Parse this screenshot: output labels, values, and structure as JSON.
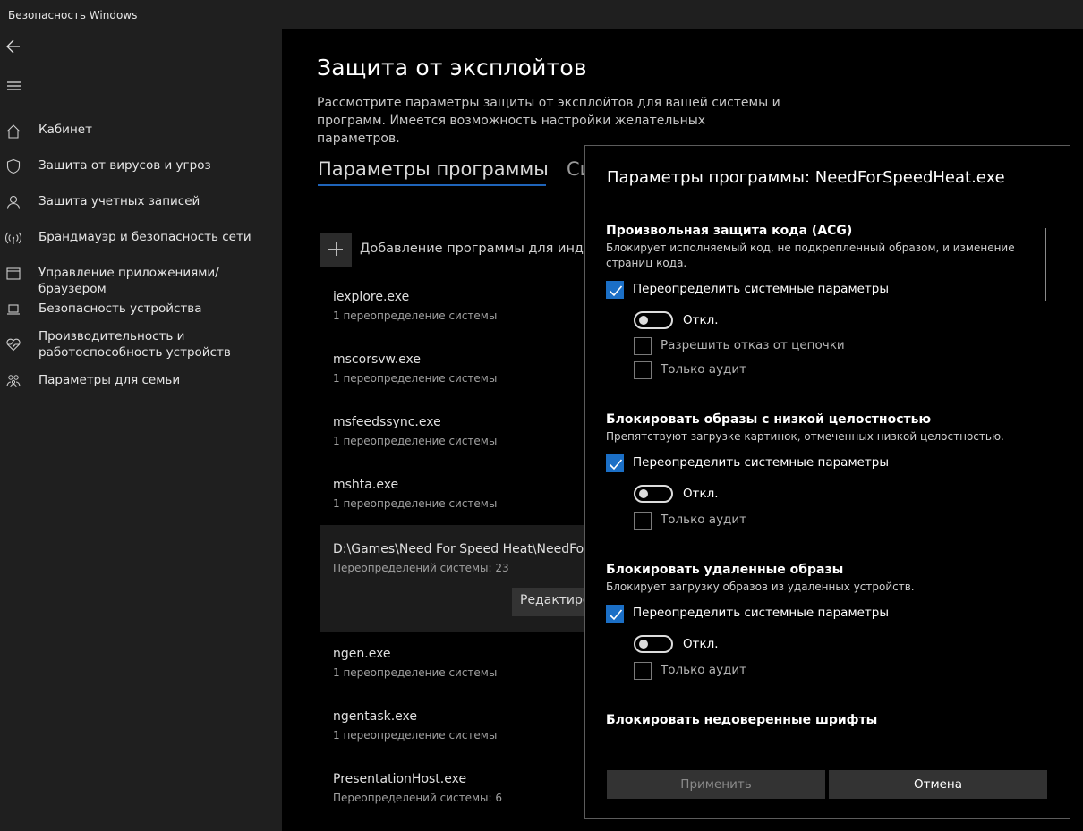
{
  "window": {
    "title": "Безопасность Windows"
  },
  "sidebar": {
    "items": [
      {
        "label": "Кабинет",
        "icon": "home-icon"
      },
      {
        "label": "Защита от вирусов и угроз",
        "icon": "shield-icon"
      },
      {
        "label": "Защита учетных записей",
        "icon": "person-icon"
      },
      {
        "label": "Брандмауэр и безопасность сети",
        "icon": "wifi-icon"
      },
      {
        "label": "Управление приложениями/браузером",
        "icon": "app-browser-icon"
      },
      {
        "label": "Безопасность устройства",
        "icon": "laptop-icon"
      },
      {
        "label": "Производительность и работоспособность устройств",
        "icon": "heart-icon"
      },
      {
        "label": "Параметры для семьи",
        "icon": "family-icon"
      }
    ]
  },
  "main": {
    "title": "Защита от эксплойтов",
    "description": "Рассмотрите параметры защиты от эксплойтов для вашей системы и программ. Имеется возможность настройки желательных параметров.",
    "tabs": [
      "Параметры программы",
      "Си"
    ],
    "add_label": "Добавление программы для индиви",
    "programs": [
      {
        "name": "iexplore.exe",
        "sub": "1 переопределение системы"
      },
      {
        "name": "mscorsvw.exe",
        "sub": "1 переопределение системы"
      },
      {
        "name": "msfeedssync.exe",
        "sub": "1 переопределение системы"
      },
      {
        "name": "mshta.exe",
        "sub": "1 переопределение системы"
      },
      {
        "name": "D:\\Games\\Need For Speed Heat\\NeedForS",
        "sub": "Переопределений системы: 23",
        "button": "Редактиров"
      },
      {
        "name": "ngen.exe",
        "sub": "1 переопределение системы"
      },
      {
        "name": "ngentask.exe",
        "sub": "1 переопределение системы"
      },
      {
        "name": "PresentationHost.exe",
        "sub": "Переопределений системы: 6"
      }
    ]
  },
  "dialog": {
    "title": "Параметры программы: NeedForSpeedHeat.exe",
    "sections": [
      {
        "title": "Произвольная защита кода (ACG)",
        "desc": "Блокирует исполняемый код, не подкрепленный образом, и изменение страниц кода.",
        "override": "Переопределить системные параметры",
        "toggle": "Откл.",
        "options": [
          "Разрешить отказ от цепочки",
          "Только аудит"
        ]
      },
      {
        "title": "Блокировать образы с низкой целостностью",
        "desc": "Препятствуют загрузке картинок, отмеченных низкой целостностью.",
        "override": "Переопределить системные параметры",
        "toggle": "Откл.",
        "options": [
          "Только аудит"
        ]
      },
      {
        "title": "Блокировать удаленные образы",
        "desc": "Блокирует загрузку образов из удаленных устройств.",
        "override": "Переопределить системные параметры",
        "toggle": "Откл.",
        "options": [
          "Только аудит"
        ]
      },
      {
        "title": "Блокировать недоверенные шрифты"
      }
    ],
    "apply_label": "Применить",
    "cancel_label": "Отмена"
  },
  "colors": {
    "accent": "#1b6fc6",
    "sidebar_bg": "#1f1f1f",
    "dialog_border": "#5c5c5c"
  }
}
